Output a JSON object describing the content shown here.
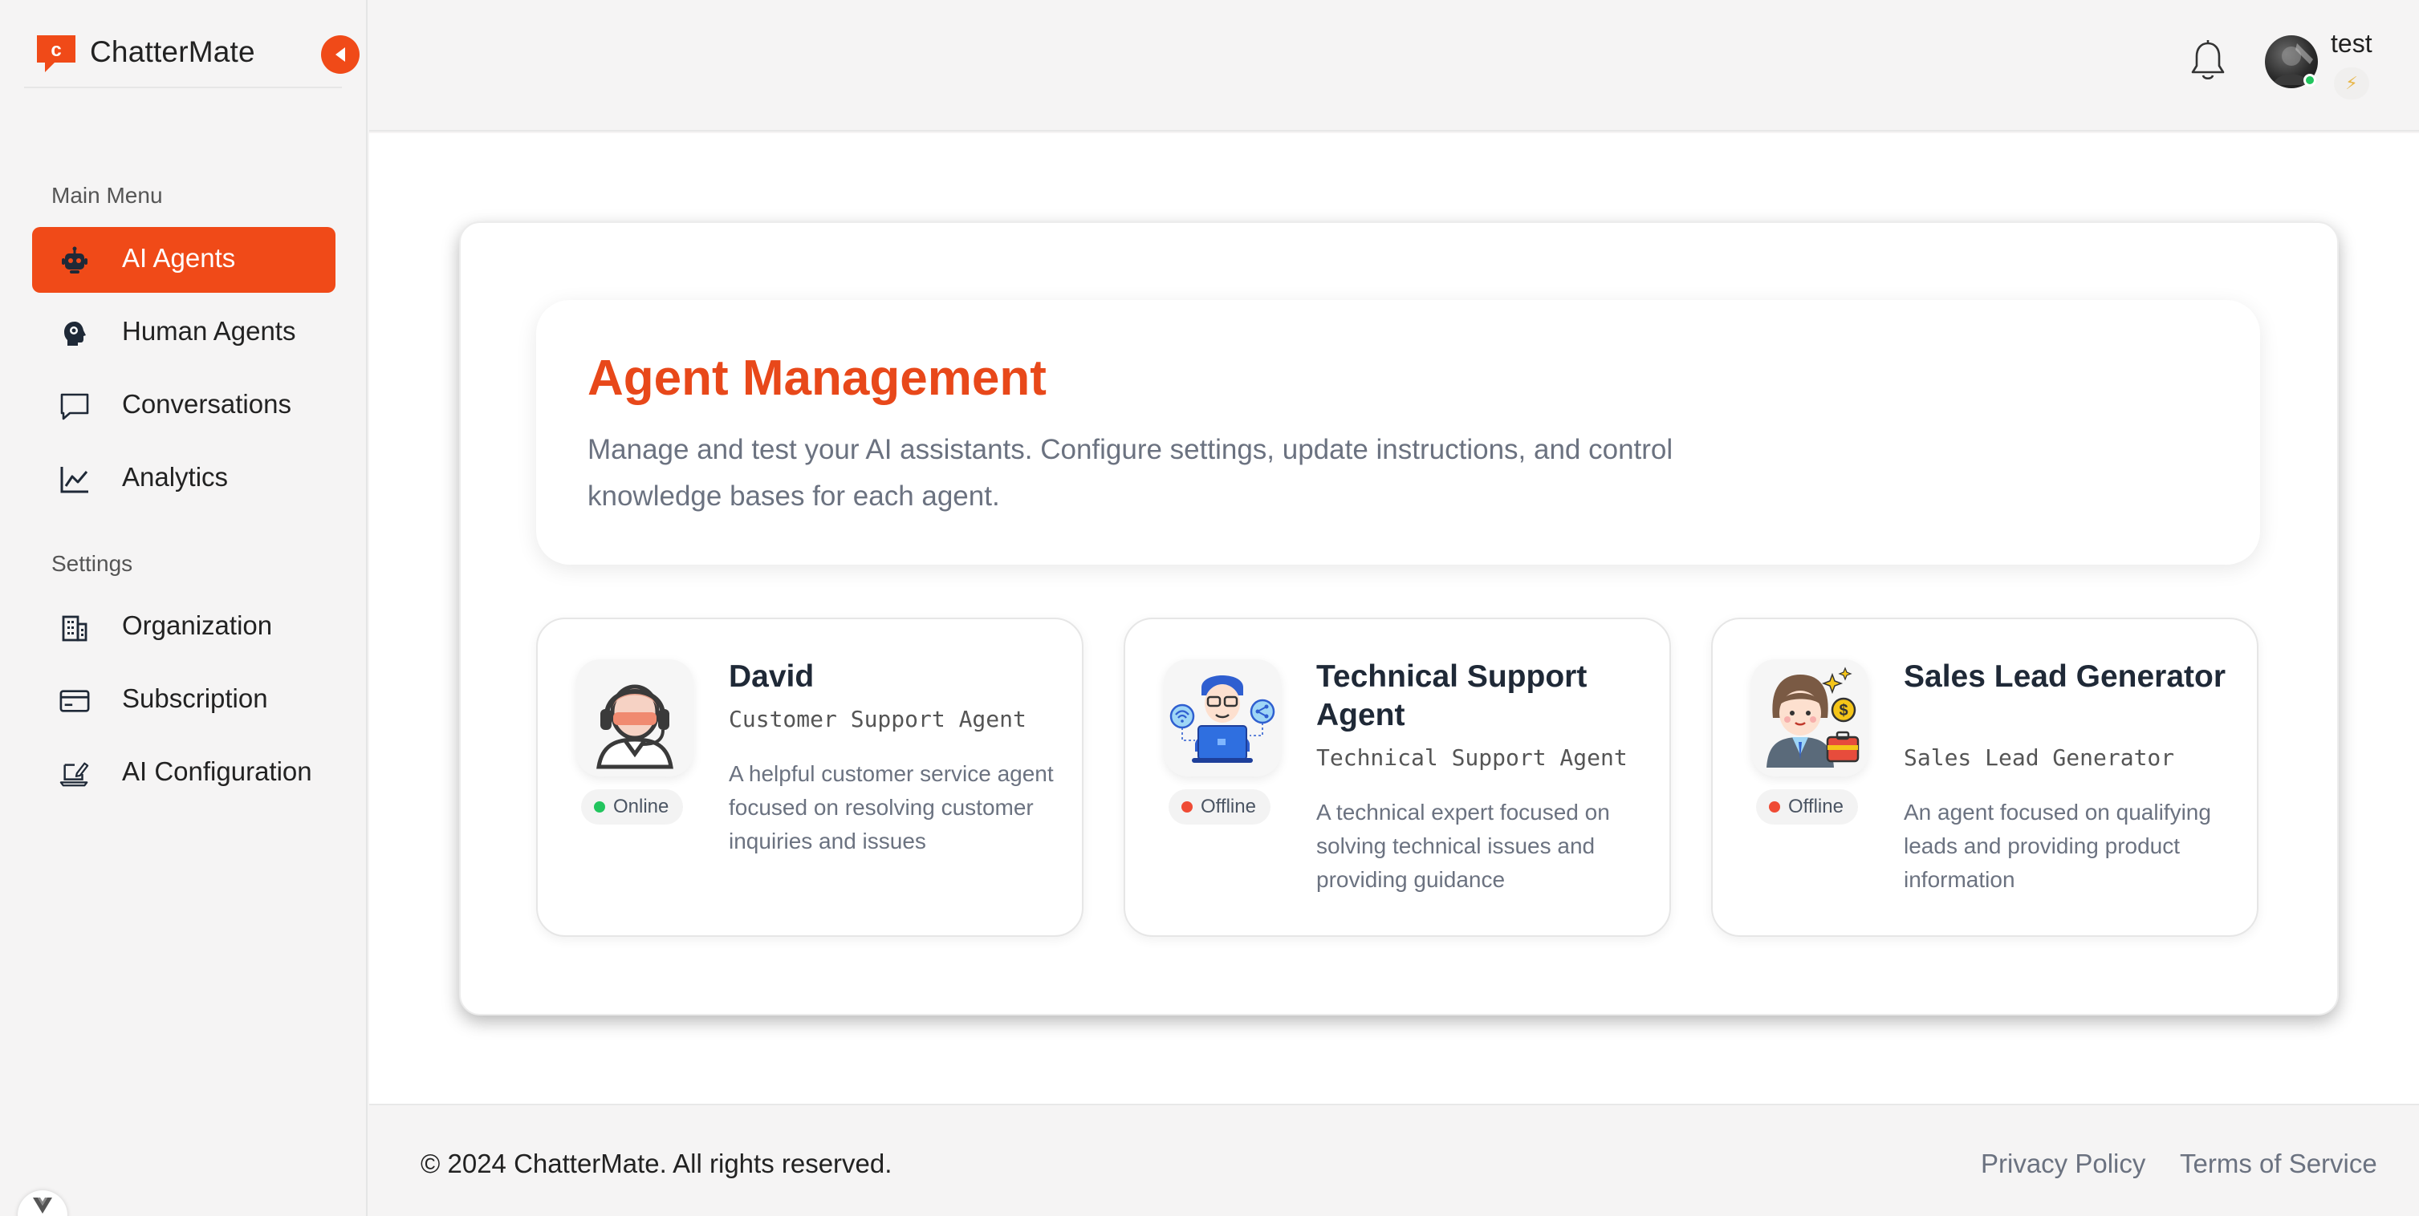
{
  "colors": {
    "accent": "#f04a18",
    "title": "#e8481a",
    "online": "#22c55e",
    "offline": "#ef4b35"
  },
  "sidebar": {
    "brand": "ChatterMate",
    "main_menu_label": "Main Menu",
    "settings_label": "Settings",
    "main_items": [
      {
        "label": "AI Agents",
        "icon": "robot-icon",
        "active": true
      },
      {
        "label": "Human Agents",
        "icon": "human-head-icon"
      },
      {
        "label": "Conversations",
        "icon": "chat-bubble-icon"
      },
      {
        "label": "Analytics",
        "icon": "line-chart-icon"
      }
    ],
    "settings_items": [
      {
        "label": "Organization",
        "icon": "building-icon"
      },
      {
        "label": "Subscription",
        "icon": "credit-card-icon"
      },
      {
        "label": "AI Configuration",
        "icon": "laptop-edit-icon"
      }
    ]
  },
  "header": {
    "username": "test",
    "user_badge": "⚡"
  },
  "main": {
    "title": "Agent Management",
    "description": "Manage and test your AI assistants. Configure settings, update instructions, and control knowledge bases for each agent.",
    "agents": [
      {
        "name": "David",
        "role": "Customer Support Agent",
        "description": "A helpful customer service agent focused on resolving customer inquiries and issues",
        "status": "Online"
      },
      {
        "name": "Technical Support Agent",
        "role": "Technical Support Agent",
        "description": "A technical expert focused on solving technical issues and providing guidance",
        "status": "Offline"
      },
      {
        "name": "Sales Lead Generator",
        "role": "Sales Lead Generator",
        "description": "An agent focused on qualifying leads and providing product information",
        "status": "Offline"
      }
    ]
  },
  "footer": {
    "copyright": "© 2024 ChatterMate. All rights reserved.",
    "privacy": "Privacy Policy",
    "terms": "Terms of Service"
  }
}
